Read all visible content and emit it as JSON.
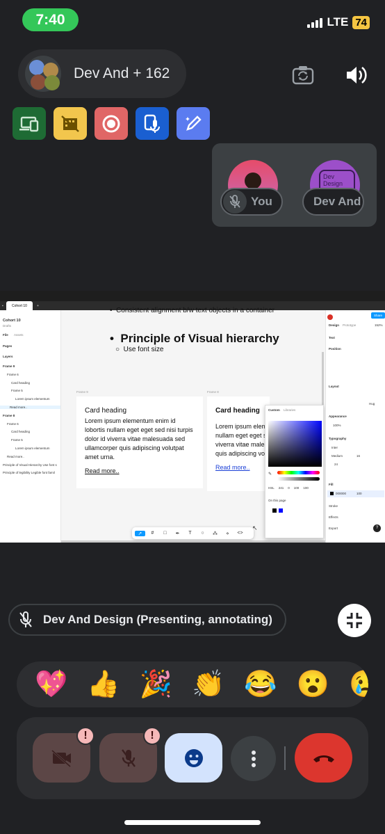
{
  "status_bar": {
    "time": "7:40",
    "network": "LTE",
    "battery": "74"
  },
  "header": {
    "participants_label": "Dev And + 162",
    "icons": [
      "avatar-group-icon",
      "switch-camera-icon",
      "speaker-icon"
    ]
  },
  "quick_tiles": [
    {
      "name": "devices-icon",
      "color": "#1e6b34"
    },
    {
      "name": "camera-off-icon",
      "color": "#f2c64d"
    },
    {
      "name": "record-icon",
      "color": "#e06666"
    },
    {
      "name": "mic-note-icon",
      "color": "#1a5fd1"
    },
    {
      "name": "edit-sparkle-icon",
      "color": "#5b7cf0"
    }
  ],
  "self_view": {
    "you_label": "You",
    "other_label": "Dev And",
    "other_avatar_text": "Dev Design"
  },
  "shared_screen": {
    "browser_tab": "Cohort 10",
    "file_name": "Cohort 10",
    "file_sub": "Drafts",
    "left_tabs": [
      "File",
      "Assets"
    ],
    "pages_label": "Pages",
    "layers_label": "Layers",
    "layers": [
      "Frame 9",
      "Frame 6",
      "Card heading",
      "Frame 5",
      "Lorem ipsum elementum",
      "Read more..",
      "Frame 8",
      "Frame 6",
      "Card heading",
      "Frame 5",
      "Lorem ipsum elementum",
      "Read more..",
      "Principle of Visual Hierarchy Use font s",
      "Principle of legibility Legible font famil"
    ],
    "bullet_top": "Consistent alignment b/w text objects in a container",
    "heading": "Principle of Visual hierarchy",
    "sub_bullet": "Use font size",
    "frame_label_1": "Frame 9",
    "frame_label_2": "Frame 8",
    "card1": {
      "title": "Card heading",
      "body": "Lorem ipsum elementum enim id lobortis nullam eget eget sed nisi turpis dolor id viverra vitae malesuada sed ullamcorper quis adipiscing volutpat amet urna.",
      "link": "Read more.."
    },
    "card2": {
      "title": "Card heading",
      "body": "Lorem ipsum elem nullam eget eget s viverra vitae males quis adipiscing vol",
      "link": "Read more.."
    },
    "picker": {
      "tabs": [
        "Custom",
        "Libraries"
      ],
      "mode": "HSL",
      "h": "241",
      "s": "0",
      "l": "100",
      "a": "100",
      "on_page": "On this page"
    },
    "right_panel": {
      "tabs": [
        "Design",
        "Prototype"
      ],
      "zoom": "152%",
      "share": "Share",
      "section_text": "Text",
      "position": "Position",
      "layout": "Layout",
      "appearance": "Appearance",
      "opacity": "100%",
      "typography": "Typography",
      "font": "Inter",
      "weight": "Medium",
      "size": "16",
      "line_height": "24",
      "fill": "Fill",
      "fill_hex": "000000",
      "fill_pct": "100",
      "stroke": "Stroke",
      "effects": "Effects",
      "export": "Export",
      "hug": "Hug"
    }
  },
  "presenter": {
    "label": "Dev And Design (Presenting, annotating)"
  },
  "reactions": [
    "💖",
    "👍",
    "🎉",
    "👏",
    "😂",
    "😮",
    "😢"
  ],
  "controls": {
    "camera_color": "#5c4646",
    "mic_color": "#5c4646",
    "emoji_color": "#d3e3fd",
    "more_color": "#3c4043",
    "end_color": "#dc362e",
    "warn_mark": "!"
  }
}
